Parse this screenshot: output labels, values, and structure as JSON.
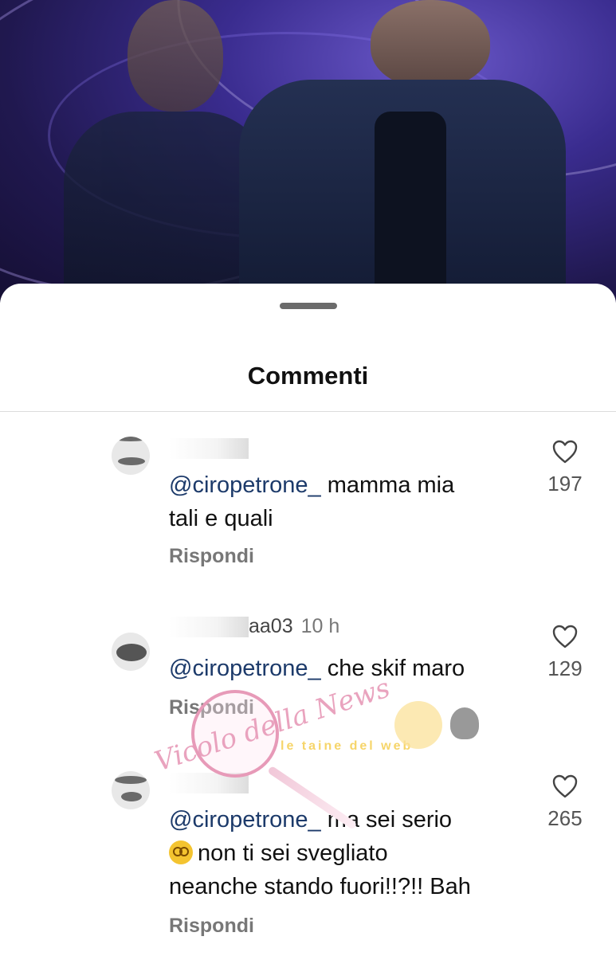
{
  "sheet": {
    "title": "Commenti"
  },
  "comments": [
    {
      "username": "",
      "time": "",
      "mention": "@ciropetrone_",
      "text_line1": "mamma mia",
      "text_line2": "tali e quali",
      "reply_label": "Rispondi",
      "likes": "197"
    },
    {
      "username": "aa03",
      "time": "10 h",
      "mention": "@ciropetrone_",
      "text_line1": "che skif maro",
      "reply_label": "Rispondi",
      "likes": "129"
    },
    {
      "username": "",
      "time": "",
      "mention": "@ciropetrone_",
      "text_line1": "ma sei serio",
      "emoji": "woozy-face-emoji",
      "text_line2": "non ti sei svegliato",
      "text_line3": "neanche stando fuori!!?!! Bah",
      "reply_label": "Rispondi",
      "likes": "265"
    }
  ],
  "watermark": {
    "text1": "Vicolo della News",
    "text2": "le taine del web"
  },
  "colors": {
    "mention": "#1c3a6a",
    "watermark_pink": "#e79ab8"
  },
  "icons": [
    "heart-icon"
  ]
}
